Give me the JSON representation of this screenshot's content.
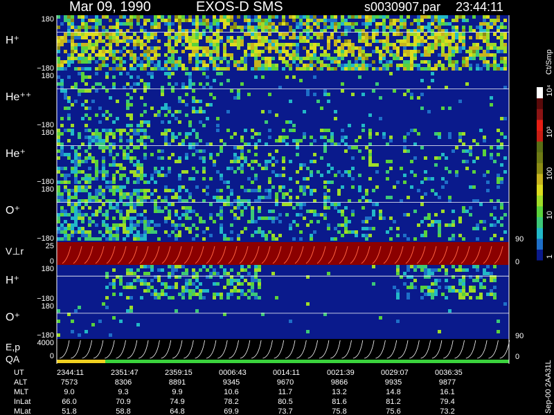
{
  "header": {
    "date": "Mar 09, 1990",
    "instrument": "EXOS-D SMS",
    "file": "s0030907.par",
    "time": "23:44:11"
  },
  "colorbar": {
    "unit_label": "Ct/Smp",
    "tick_labels": [
      "1",
      "10",
      "100",
      "10³",
      "10⁴"
    ],
    "colors": [
      "#0a1a8c",
      "#1e6fc8",
      "#22b8c8",
      "#3cc878",
      "#5ad23c",
      "#a0dc28",
      "#dcdc1e",
      "#c8b41e",
      "#8c8c14",
      "#6e7a14",
      "#5a6e14",
      "#c81e14",
      "#e61e14",
      "#8c1414",
      "#5a0a0a",
      "#ffffff"
    ]
  },
  "panels": [
    {
      "id": "h_plus_1",
      "label": "H⁺",
      "ytop": "180",
      "ybot": "−180"
    },
    {
      "id": "he_pp",
      "label": "He⁺⁺",
      "ytop": "180",
      "ybot": "−180"
    },
    {
      "id": "he_plus",
      "label": "He⁺",
      "ytop": "180",
      "ybot": "−180"
    },
    {
      "id": "o_plus_1",
      "label": "O⁺",
      "ytop": "180",
      "ybot": "−180",
      "right_label": "90"
    },
    {
      "id": "vr",
      "label": "V⊥r",
      "ytop": "25",
      "ybot": "0",
      "right_label": "0"
    },
    {
      "id": "h_plus_2",
      "label": "H⁺",
      "ytop": "180",
      "ybot": "−180"
    },
    {
      "id": "o_plus_2",
      "label": "O⁺",
      "ytop": "180",
      "ybot": "−180",
      "right_label": "90"
    },
    {
      "id": "ep",
      "label": "E,p",
      "ytop": "4000",
      "ybot": "0",
      "right_label": "0"
    },
    {
      "id": "qa",
      "label": "QA"
    }
  ],
  "table": {
    "row_labels": [
      "UT",
      "ALT",
      "MLT",
      "InLat",
      "MLat"
    ],
    "columns": [
      {
        "UT": "2344:11",
        "ALT": "7573",
        "MLT": "9.0",
        "InLat": "66.0",
        "MLat": "51.8"
      },
      {
        "UT": "2351:47",
        "ALT": "8306",
        "MLT": "9.3",
        "InLat": "70.9",
        "MLat": "58.8"
      },
      {
        "UT": "2359:15",
        "ALT": "8891",
        "MLT": "9.9",
        "InLat": "74.9",
        "MLat": "64.8"
      },
      {
        "UT": "0006:43",
        "ALT": "9345",
        "MLT": "10.6",
        "InLat": "78.2",
        "MLat": "69.9"
      },
      {
        "UT": "0014:11",
        "ALT": "9670",
        "MLT": "11.7",
        "InLat": "80.5",
        "MLat": "73.7"
      },
      {
        "UT": "0021:39",
        "ALT": "9866",
        "MLT": "13.2",
        "InLat": "81.6",
        "MLat": "75.8"
      },
      {
        "UT": "0029:07",
        "ALT": "9935",
        "MLT": "14.8",
        "InLat": "81.2",
        "MLat": "75.6"
      },
      {
        "UT": "0036:35",
        "ALT": "9877",
        "MLT": "16.1",
        "InLat": "79.4",
        "MLat": "73.2"
      }
    ]
  },
  "footer_note": "Sep-00 2AA31L",
  "chart_data": {
    "type": "heatmap",
    "title": "Mar 09, 1990   EXOS-D SMS   s0030907.par   23:44:11",
    "x_ticks": [
      "2344:11",
      "2351:47",
      "2359:15",
      "0006:43",
      "0014:11",
      "0021:39",
      "0029:07",
      "0036:35"
    ],
    "series": [
      {
        "name": "H⁺",
        "ylim": [
          -180,
          180
        ]
      },
      {
        "name": "He⁺⁺",
        "ylim": [
          -180,
          180
        ]
      },
      {
        "name": "He⁺",
        "ylim": [
          -180,
          180
        ]
      },
      {
        "name": "O⁺",
        "ylim": [
          -180,
          180
        ]
      },
      {
        "name": "V⊥r",
        "ylim": [
          0,
          25
        ]
      },
      {
        "name": "H⁺",
        "ylim": [
          -180,
          180
        ]
      },
      {
        "name": "O⁺",
        "ylim": [
          -180,
          180
        ]
      },
      {
        "name": "E,p",
        "ylim": [
          0,
          4000
        ]
      }
    ],
    "colorbar_unit": "Ct/Smp",
    "colorbar_ticks": [
      "1",
      "10",
      "100",
      "10³",
      "10⁴"
    ]
  }
}
